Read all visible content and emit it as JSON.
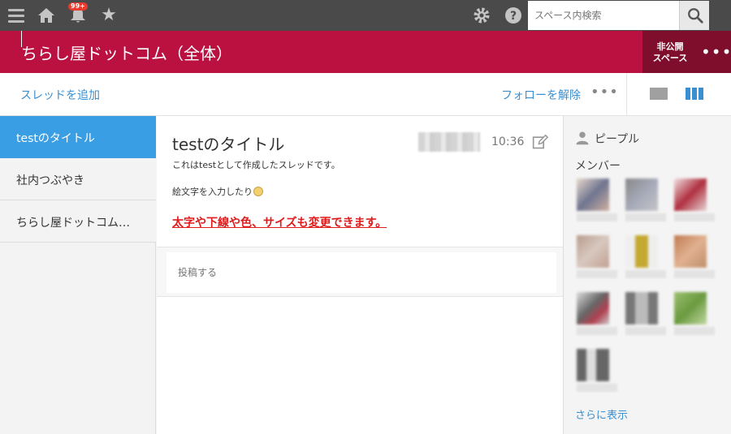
{
  "topbar": {
    "notification_count": "99+",
    "search_placeholder": "スペース内検索"
  },
  "space": {
    "title": "ちらし屋ドットコム（全体）",
    "private_label": "非公開\nスペース",
    "menu_glyph": "•••"
  },
  "actions": {
    "add_thread": "スレッドを追加",
    "unfollow": "フォローを解除",
    "more_glyph": "•••"
  },
  "threads": [
    {
      "label": "testのタイトル",
      "active": true
    },
    {
      "label": "社内つぶやき",
      "active": false
    },
    {
      "label": "ちらし屋ドットコム（全体）",
      "active": false
    }
  ],
  "thread": {
    "title": "testのタイトル",
    "time": "10:36",
    "line1": "これはtestとして作成したスレッドです。",
    "line2": "絵文字を入力したり",
    "styled_line": "太字や下線や色、サイズも変更できます。",
    "post_placeholder": "投稿する"
  },
  "people": {
    "heading": "ピープル",
    "members_label": "メンバー",
    "more_link": "さらに表示"
  },
  "colors": {
    "space_header": "#bb1140",
    "private_box": "#7e0e2b",
    "accent_blue": "#3a9ee4",
    "link_blue": "#3a8fd0",
    "styled_red": "#e01b1b"
  }
}
